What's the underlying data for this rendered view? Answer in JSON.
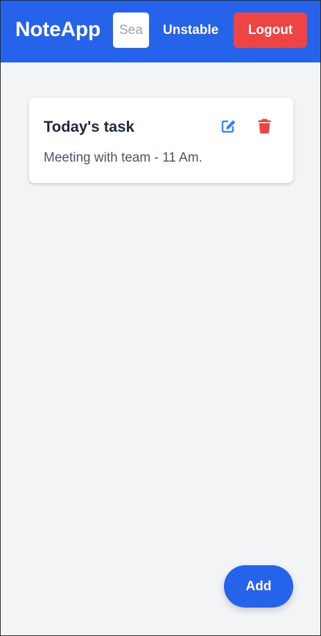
{
  "navbar": {
    "brand": "NoteApp",
    "search_placeholder": "Search",
    "user_name": "Unstable",
    "logout_label": "Logout"
  },
  "notes": [
    {
      "title": "Today's task",
      "body": "Meeting with team - 11 Am.",
      "edit_icon": "edit-icon",
      "delete_icon": "trash-icon"
    }
  ],
  "add_button_label": "Add",
  "colors": {
    "primary": "#2563eb",
    "danger": "#ef4444",
    "background": "#f3f4f6",
    "card": "#ffffff",
    "title_text": "#1f2937",
    "body_text": "#4b5563"
  }
}
